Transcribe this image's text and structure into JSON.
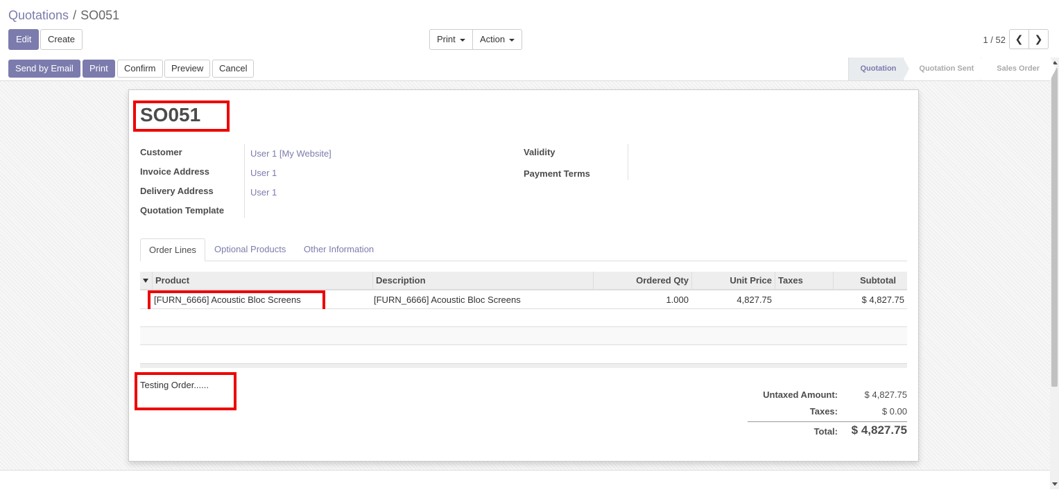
{
  "breadcrumb": {
    "parent": "Quotations",
    "separator": "/",
    "current": "SO051"
  },
  "control_panel": {
    "edit_label": "Edit",
    "create_label": "Create",
    "print_label": "Print",
    "action_label": "Action",
    "pager_text": "1 / 52"
  },
  "statusbar": {
    "buttons": [
      "Send by Email",
      "Print",
      "Confirm",
      "Preview",
      "Cancel"
    ],
    "stages": [
      "Quotation",
      "Quotation Sent",
      "Sales Order"
    ],
    "active_stage": "Quotation"
  },
  "form": {
    "name": "SO051",
    "fields_left": [
      {
        "label": "Customer",
        "value": "User 1 [My Website]"
      },
      {
        "label": "Invoice Address",
        "value": "User 1"
      },
      {
        "label": "Delivery Address",
        "value": "User 1"
      },
      {
        "label": "Quotation Template",
        "value": ""
      }
    ],
    "fields_right": [
      {
        "label": "Validity",
        "value": ""
      },
      {
        "label": "Payment Terms",
        "value": ""
      }
    ],
    "tabs": [
      "Order Lines",
      "Optional Products",
      "Other Information"
    ],
    "table": {
      "columns": [
        "Product",
        "Description",
        "Ordered Qty",
        "Unit Price",
        "Taxes",
        "Subtotal"
      ],
      "rows": [
        {
          "product": "[FURN_6666] Acoustic Bloc Screens",
          "description": "[FURN_6666] Acoustic Bloc Screens",
          "qty": "1.000",
          "unit_price": "4,827.75",
          "taxes": "",
          "subtotal": "$ 4,827.75"
        }
      ]
    },
    "note": "Testing Order......",
    "totals": {
      "untaxed_label": "Untaxed Amount:",
      "untaxed_value": "$ 4,827.75",
      "taxes_label": "Taxes:",
      "taxes_value": "$ 0.00",
      "total_label": "Total:",
      "total_value": "$ 4,827.75"
    }
  },
  "colors": {
    "brand": "#7c7bad",
    "highlight": "#ee0000"
  }
}
